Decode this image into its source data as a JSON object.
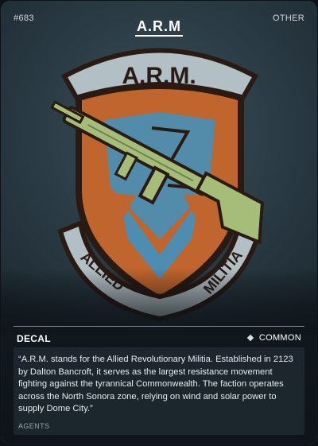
{
  "card": {
    "id": "#683",
    "category": "OTHER",
    "title": "A.R.M",
    "type": "DECAL",
    "rarity": "COMMON",
    "description": "“A.R.M. stands for the Allied Revolutionary Militia. Established in 2123 by Dalton Bancroft, it serves as the largest resistance movement fighting against the tyrannical Commonwealth. The faction operates across the North Sonora zone, relying on wind and solar power to supply Dome City.”",
    "tag": "AGENTS"
  },
  "artwork": {
    "banner_text": "A.R.M.",
    "lower_left_text": "ALLIED",
    "lower_right_text": "MILITIA",
    "icon": "rifle-emblem-icon",
    "colors": {
      "background": "#2f424c",
      "banner": "#c7d3d8",
      "shield_orange": "#c0652e",
      "shield_blue": "#4d8db2",
      "rifle_green": "#a6bd79",
      "outline": "#1f1410"
    }
  }
}
